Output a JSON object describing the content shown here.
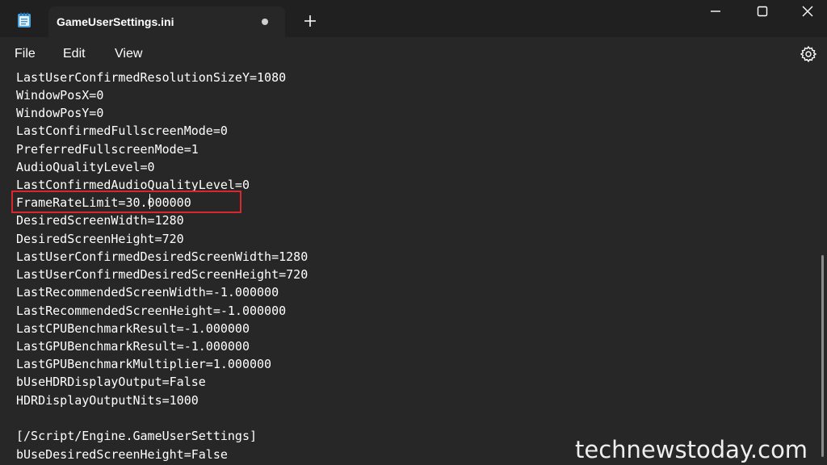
{
  "window": {
    "tab_title": "GameUserSettings.ini",
    "app_icon": "notepad-icon",
    "new_tab_icon": "plus-icon",
    "controls": [
      "minimize-icon",
      "maximize-icon",
      "close-icon"
    ]
  },
  "menu": {
    "file": "File",
    "edit": "Edit",
    "view": "View",
    "settings_icon": "gear-icon"
  },
  "editor": {
    "lines": [
      "LastUserConfirmedResolutionSizeY=1080",
      "WindowPosX=0",
      "WindowPosY=0",
      "LastConfirmedFullscreenMode=0",
      "PreferredFullscreenMode=1",
      "AudioQualityLevel=0",
      "LastConfirmedAudioQualityLevel=0",
      "FrameRateLimit=30.000000",
      "DesiredScreenWidth=1280",
      "DesiredScreenHeight=720",
      "LastUserConfirmedDesiredScreenWidth=1280",
      "LastUserConfirmedDesiredScreenHeight=720",
      "LastRecommendedScreenWidth=-1.000000",
      "LastRecommendedScreenHeight=-1.000000",
      "LastCPUBenchmarkResult=-1.000000",
      "LastGPUBenchmarkResult=-1.000000",
      "LastGPUBenchmarkMultiplier=1.000000",
      "bUseHDRDisplayOutput=False",
      "HDRDisplayOutputNits=1000",
      "",
      "[/Script/Engine.GameUserSettings]",
      "bUseDesiredScreenHeight=False"
    ],
    "highlighted_line": "FrameRateLimit=30.000000",
    "highlight_color": "#d9272e"
  },
  "watermark": "technewstoday.com"
}
